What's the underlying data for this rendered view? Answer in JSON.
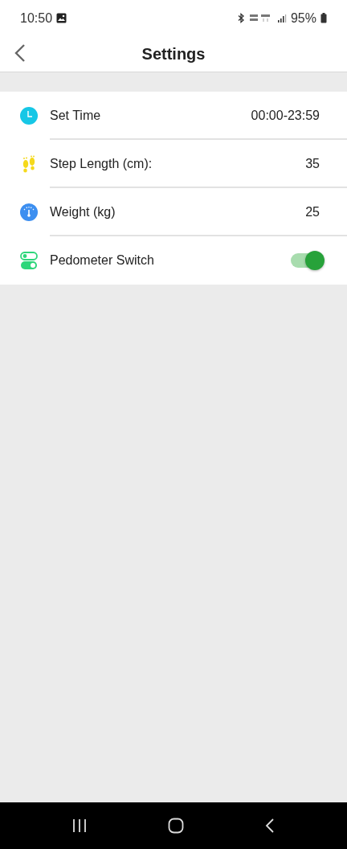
{
  "status_bar": {
    "time": "10:50",
    "battery": "95%"
  },
  "header": {
    "title": "Settings"
  },
  "rows": [
    {
      "kind": "value",
      "label": "Set Time",
      "value": "00:00-23:59"
    },
    {
      "kind": "value",
      "label": "Step Length (cm):",
      "value": "35"
    },
    {
      "kind": "value",
      "label": "Weight (kg)",
      "value": "25"
    },
    {
      "kind": "switch",
      "label": "Pedometer Switch",
      "on": true
    }
  ]
}
